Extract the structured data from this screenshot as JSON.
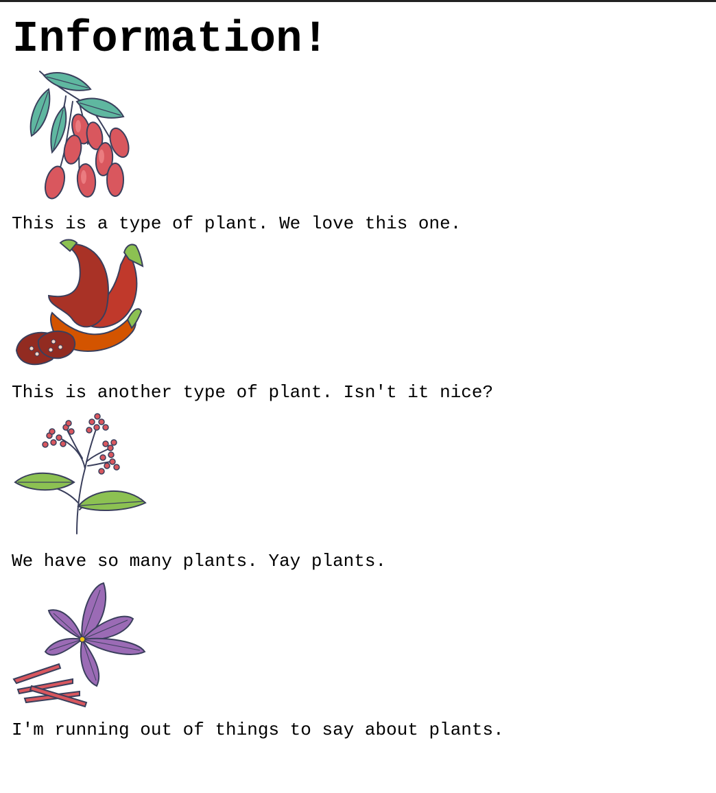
{
  "page": {
    "title": "Information!"
  },
  "plants": [
    {
      "icon": "goji-berries-icon",
      "caption": "This is a type of plant. We love this one."
    },
    {
      "icon": "chili-peppers-icon",
      "caption": "This is another type of plant. Isn't it nice?"
    },
    {
      "icon": "berry-branch-icon",
      "caption": "We have so many plants. Yay plants."
    },
    {
      "icon": "saffron-flower-icon",
      "caption": "I'm running out of things to say about plants."
    }
  ],
  "colors": {
    "outline": "#3a3f5c",
    "leaf_teal": "#5fb7a0",
    "leaf_green": "#8cc152",
    "berry_red": "#d9575e",
    "pepper_red": "#c0392b",
    "pepper_orange": "#d35400",
    "flower_purple": "#9b6bb5"
  }
}
